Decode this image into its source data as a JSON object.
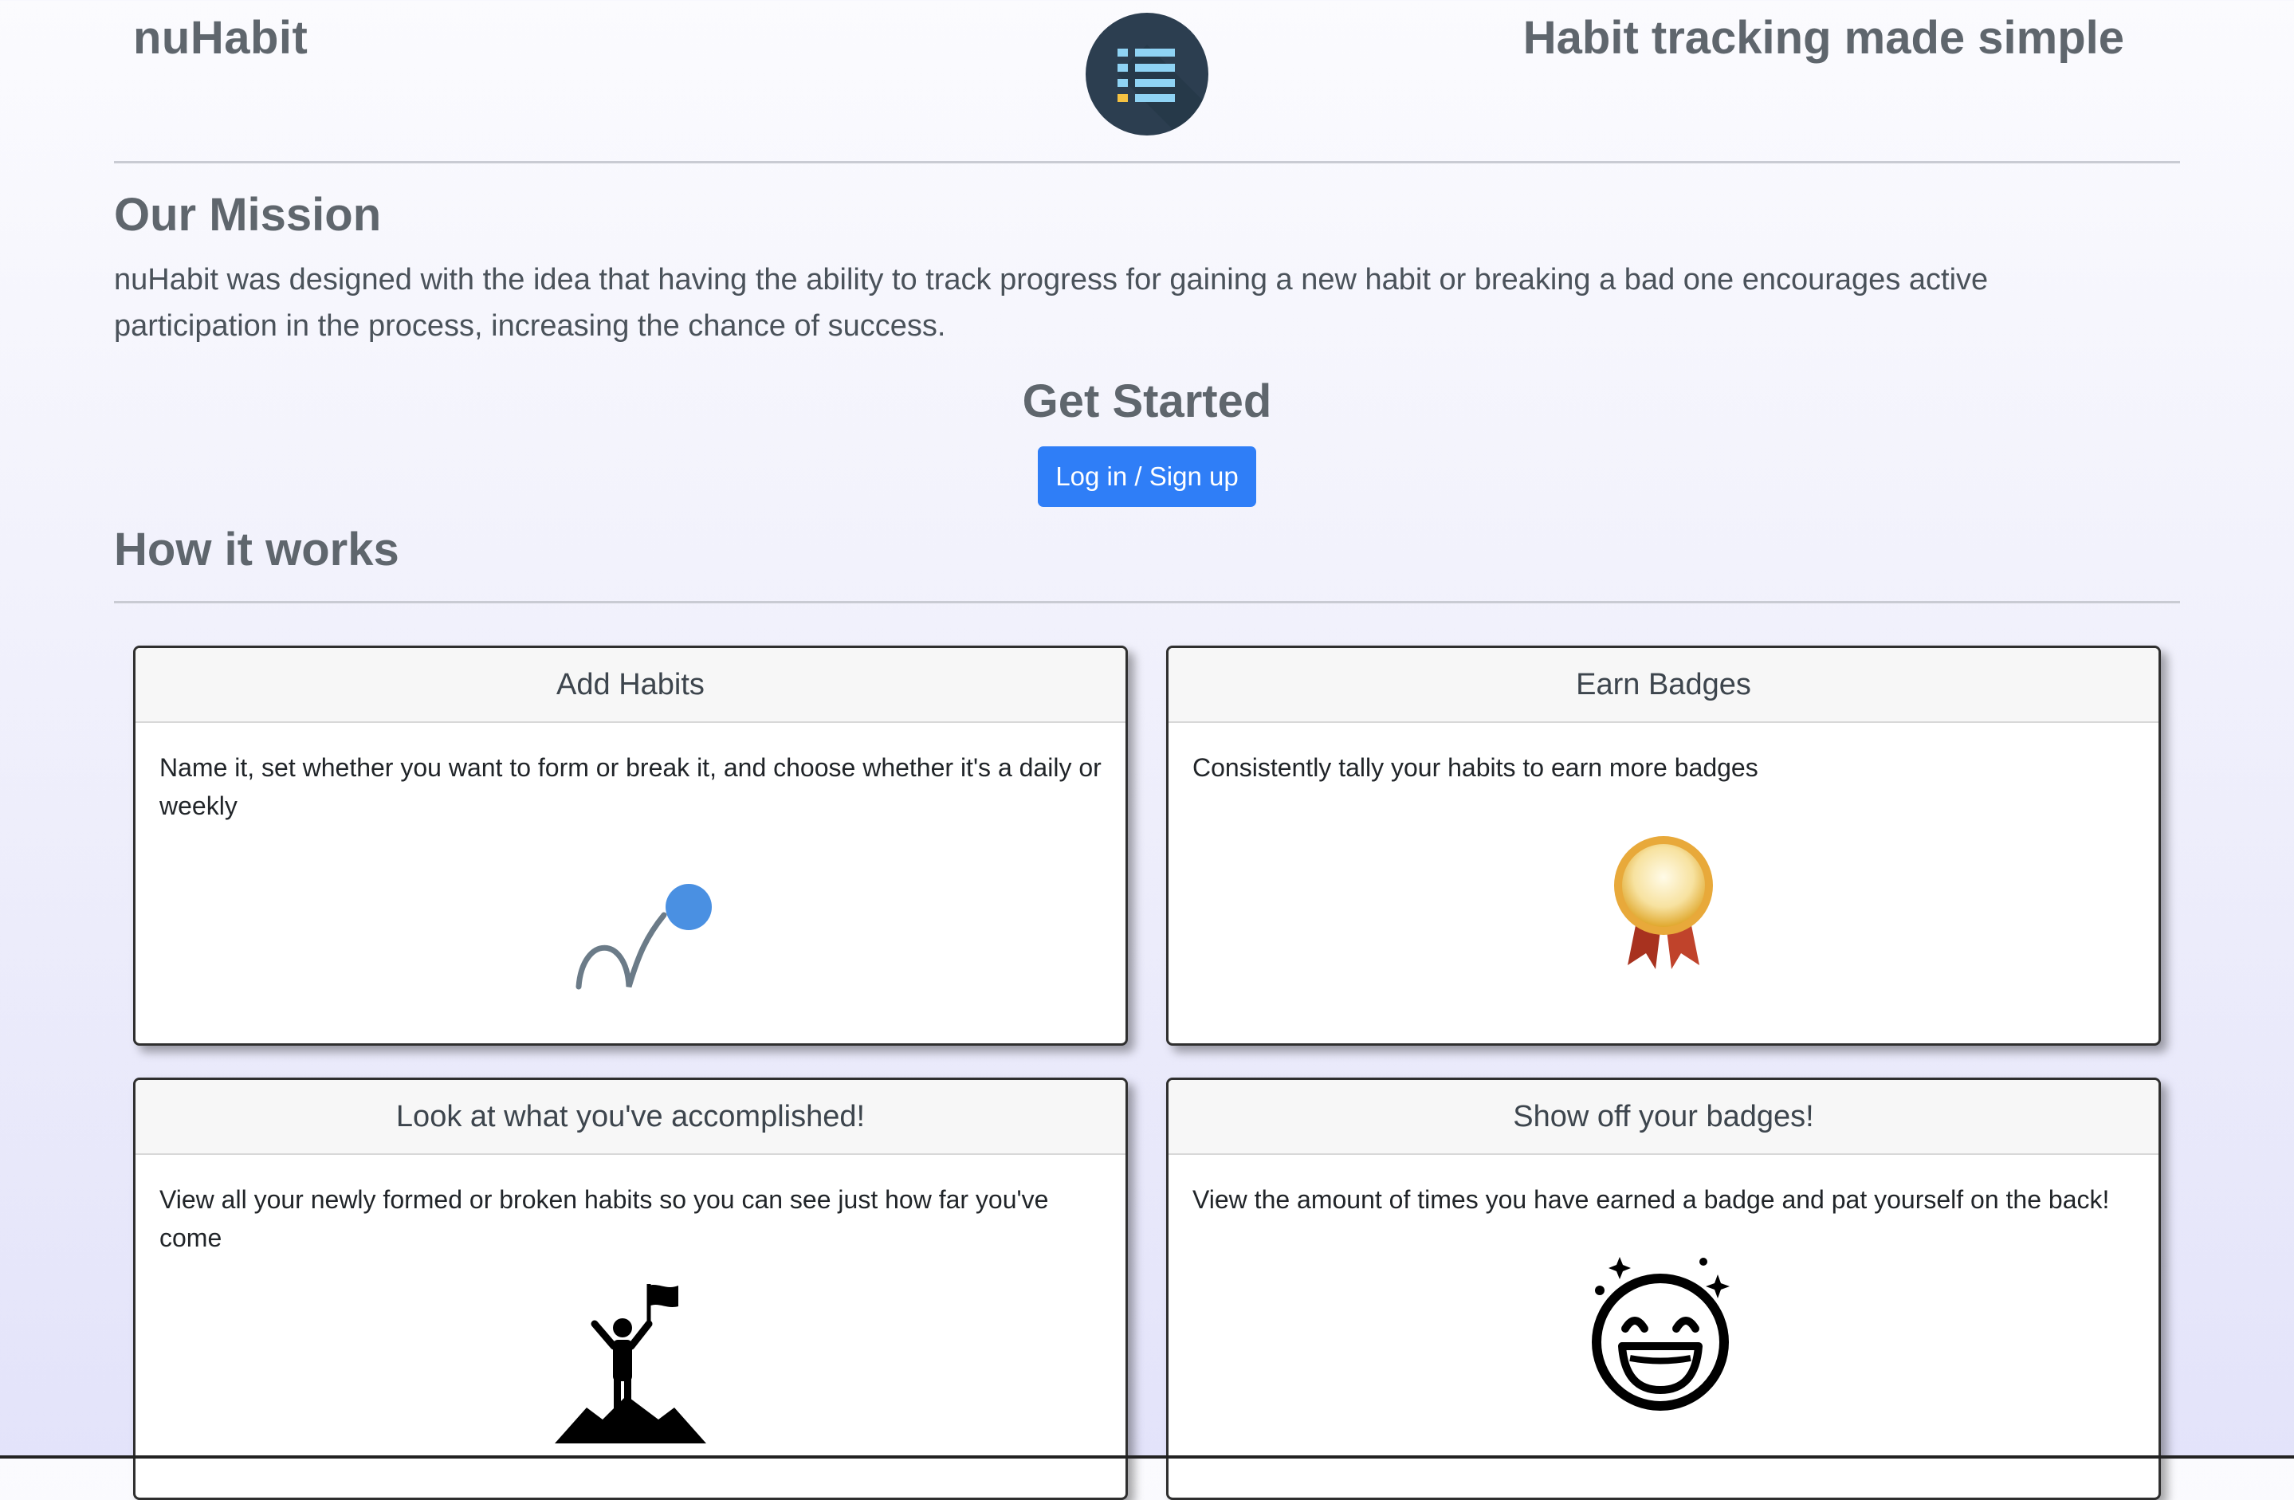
{
  "header": {
    "brand": "nuHabit",
    "tagline": "Habit tracking made simple",
    "logo_icon": "list-icon"
  },
  "mission": {
    "title": "Our Mission",
    "text": "nuHabit was designed with the idea that having the ability to track progress for gaining a new habit or breaking a bad one encourages active participation in the process, increasing the chance of success."
  },
  "get_started": {
    "title": "Get Started",
    "button_label": "Log in / Sign up"
  },
  "how_it_works": {
    "title": "How it works",
    "cards": [
      {
        "title": "Add Habits",
        "text": "Name it, set whether you want to form or break it, and choose whether it's a daily or weekly",
        "icon": "bouncing-ball-icon"
      },
      {
        "title": "Earn Badges",
        "text": "Consistently tally your habits to earn more badges",
        "icon": "award-ribbon-icon"
      },
      {
        "title": "Look at what you've accomplished!",
        "text": "View all your newly formed or broken habits so you can see just how far you've come",
        "icon": "summit-flag-icon"
      },
      {
        "title": "Show off your badges!",
        "text": "View the amount of times you have earned a badge and pat yourself on the back!",
        "icon": "laughing-face-icon"
      }
    ]
  },
  "colors": {
    "primary_button": "#2f7ef7",
    "logo_background": "#2c3e50",
    "logo_lines": "#8fd3f4",
    "logo_bullet": "#f5c242",
    "ball": "#4a90e2"
  }
}
